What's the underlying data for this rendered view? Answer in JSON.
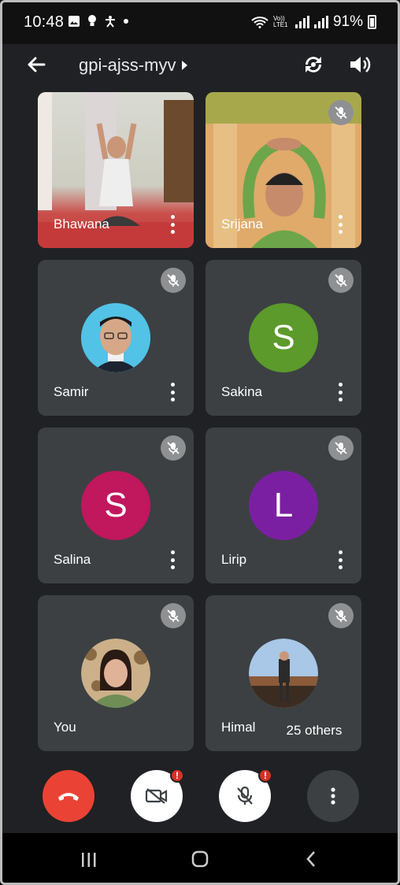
{
  "status_bar": {
    "time": "10:48",
    "battery": "91%",
    "network_label": "Vo)) LTE1"
  },
  "header": {
    "meeting_code": "gpi-ajss-myv"
  },
  "participants": [
    {
      "name": "Bhawana",
      "type": "video"
    },
    {
      "name": "Srijana",
      "type": "video",
      "muted": true
    },
    {
      "name": "Samir",
      "type": "photo",
      "muted": true
    },
    {
      "name": "Sakina",
      "type": "initial",
      "initial": "S",
      "color": "#5b9a2b",
      "muted": true
    },
    {
      "name": "Salina",
      "type": "initial",
      "initial": "S",
      "color": "#c0175d",
      "muted": true
    },
    {
      "name": "Lirip",
      "type": "initial",
      "initial": "L",
      "color": "#7b1fa2",
      "muted": true
    },
    {
      "name": "You",
      "type": "photo",
      "muted": true
    },
    {
      "name": "Himal",
      "type": "photo",
      "muted": true
    }
  ],
  "others_label": "25 others",
  "controls": {
    "end_call_color": "#ea4335",
    "camera_badge": "!",
    "mic_badge": "!"
  }
}
